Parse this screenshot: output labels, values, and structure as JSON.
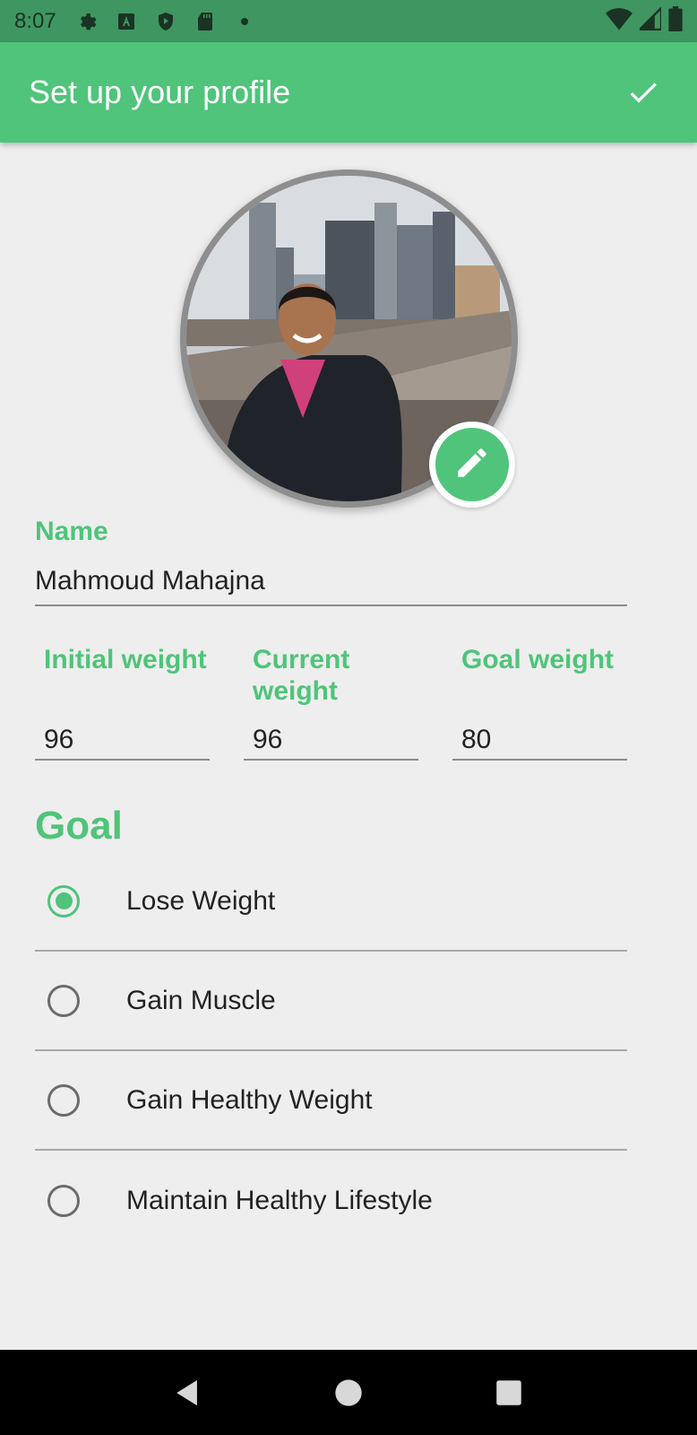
{
  "status_bar": {
    "time": "8:07",
    "icons": [
      "gear-icon",
      "a-icon",
      "shield-play-icon",
      "sdcard-icon",
      "dot-icon"
    ],
    "right_icons": [
      "wifi-icon",
      "signal-icon",
      "battery-icon"
    ]
  },
  "app_bar": {
    "title": "Set up your profile",
    "action_icon": "check-icon"
  },
  "profile": {
    "edit_icon": "pencil-icon"
  },
  "form": {
    "name_label": "Name",
    "name_value": "Mahmoud Mahajna",
    "initial_weight_label": "Initial weight",
    "initial_weight_value": "96",
    "current_weight_label": "Current weight",
    "current_weight_value": "96",
    "goal_weight_label": "Goal weight",
    "goal_weight_value": "80"
  },
  "goal": {
    "heading": "Goal",
    "options": [
      {
        "label": "Lose Weight",
        "selected": true
      },
      {
        "label": "Gain Muscle",
        "selected": false
      },
      {
        "label": "Gain Healthy Weight",
        "selected": false
      },
      {
        "label": "Maintain Healthy Lifestyle",
        "selected": false
      }
    ]
  },
  "colors": {
    "accent": "#4fc47a",
    "status_bar": "#3f9660",
    "background": "#eeeeee"
  },
  "nav_bar": {
    "icons": [
      "back-icon",
      "home-icon",
      "recents-icon"
    ]
  }
}
